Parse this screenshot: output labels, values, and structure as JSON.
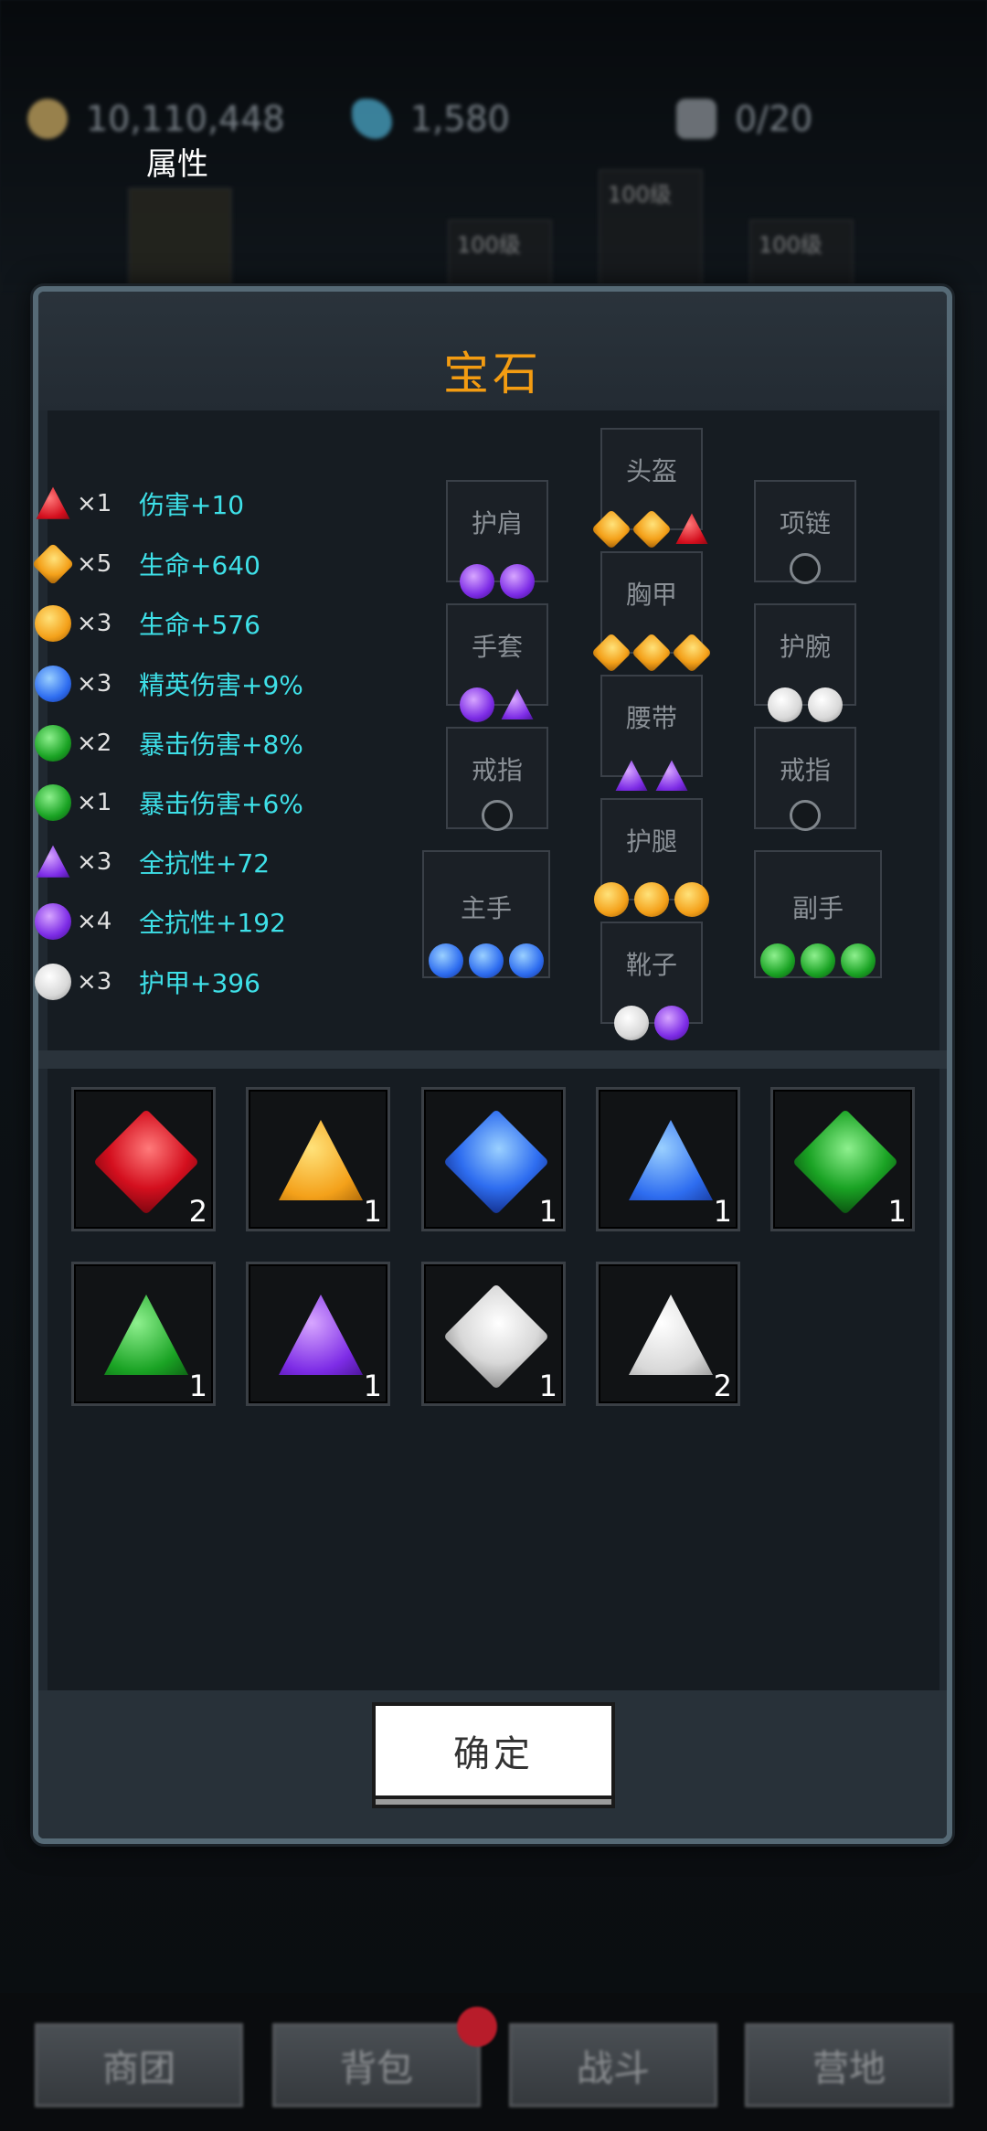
{
  "currency": {
    "gold": "10,110,448",
    "crystal": "1,580",
    "slots": "0/20"
  },
  "background_items": {
    "price_label": "100级"
  },
  "dialog": {
    "title": "宝石",
    "confirm_label": "确定"
  },
  "attributes": {
    "title": "属性",
    "rows": [
      {
        "gem": "red-triangle",
        "count": "×1",
        "text": "伤害+10"
      },
      {
        "gem": "orange-diamond",
        "count": "×5",
        "text": "生命+640"
      },
      {
        "gem": "orange-round",
        "count": "×3",
        "text": "生命+576"
      },
      {
        "gem": "blue-round",
        "count": "×3",
        "text": "精英伤害+9%"
      },
      {
        "gem": "green-round",
        "count": "×2",
        "text": "暴击伤害+8%"
      },
      {
        "gem": "green-round",
        "count": "×1",
        "text": "暴击伤害+6%"
      },
      {
        "gem": "purple-triangle",
        "count": "×3",
        "text": "全抗性+72"
      },
      {
        "gem": "purple-round",
        "count": "×4",
        "text": "全抗性+192"
      },
      {
        "gem": "white-round",
        "count": "×3",
        "text": "护甲+396"
      }
    ]
  },
  "equipment": {
    "shoulder": "护肩",
    "gloves": "手套",
    "ring_left": "戒指",
    "main_hand": "主手",
    "helmet": "头盔",
    "chest": "胸甲",
    "belt": "腰带",
    "legs": "护腿",
    "boots": "靴子",
    "necklace": "项链",
    "bracers": "护腕",
    "ring_right": "戒指",
    "off_hand": "副手"
  },
  "inventory": [
    {
      "gem": "red-diamond",
      "count": "2"
    },
    {
      "gem": "orange-triangle",
      "count": "1"
    },
    {
      "gem": "blue-diamond",
      "count": "1"
    },
    {
      "gem": "blue-triangle",
      "count": "1"
    },
    {
      "gem": "green-diamond",
      "count": "1"
    },
    {
      "gem": "green-triangle",
      "count": "1"
    },
    {
      "gem": "purple-triangle",
      "count": "1"
    },
    {
      "gem": "white-diamond",
      "count": "1"
    },
    {
      "gem": "white-triangle",
      "count": "2"
    }
  ],
  "nav": {
    "guild": "商团",
    "bag": "背包",
    "battle": "战斗",
    "camp": "营地"
  },
  "colors": {
    "title": "#f39c12",
    "attr_text": "#3ee0e8",
    "dialog_border": "#566a76"
  }
}
